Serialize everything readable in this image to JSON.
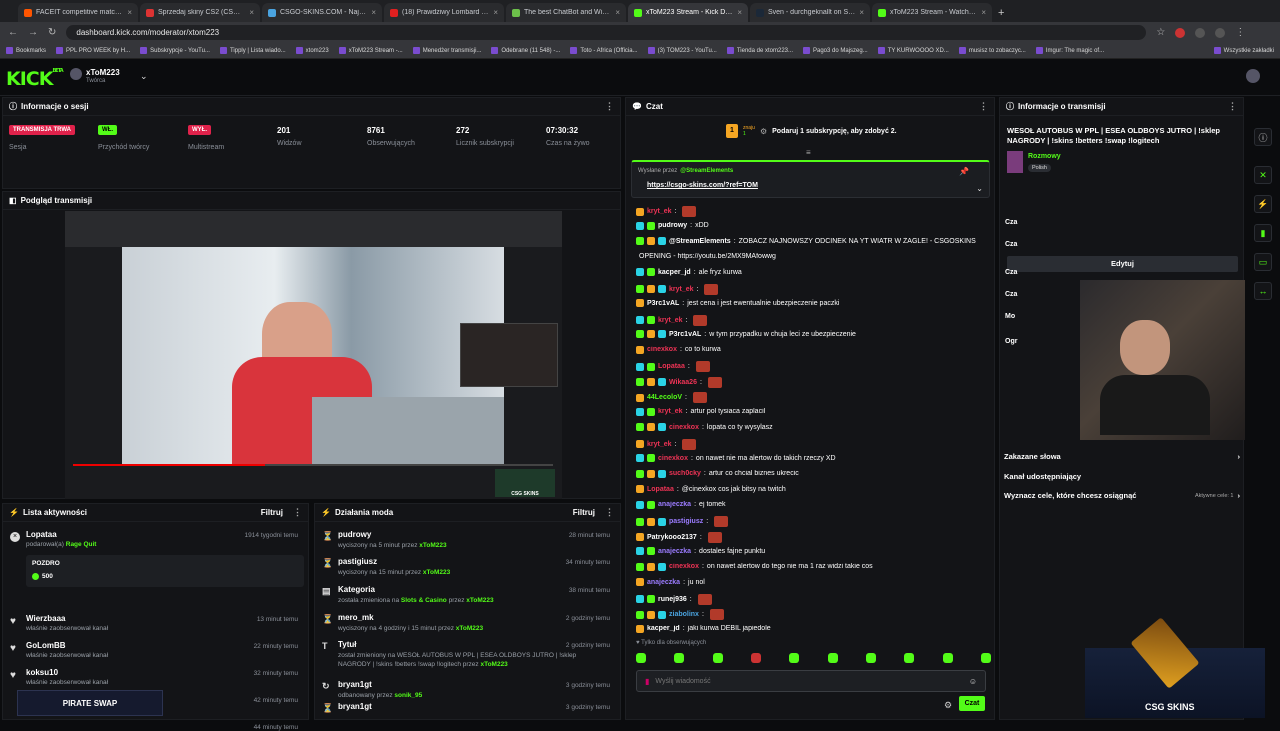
{
  "tabs": [
    {
      "title": "FACEIT competitive match - FAC",
      "color": "#ff5500"
    },
    {
      "title": "Sprzedaj skiny CS2 (CSGO) | N",
      "color": "#d33"
    },
    {
      "title": "CSGO-SKINS.COM - Najlepsze",
      "color": "#4aa3df"
    },
    {
      "title": "(18) Prawdziwy Lombard - Odc",
      "color": "#e02020"
    },
    {
      "title": "The best ChatBot and Widgets",
      "color": "#6cc04a"
    },
    {
      "title": "xToM223 Stream - Kick Dashbo",
      "color": "#53fc18"
    },
    {
      "title": "Sven - durchgeknallt on Steam",
      "color": "#1b2838"
    },
    {
      "title": "xToM223 Stream - Watch Live",
      "color": "#53fc18"
    }
  ],
  "url": "dashboard.kick.com/moderator/xtom223",
  "bookmarks": [
    "Bookmarks",
    "PPL PRO WEEK by H...",
    "Subskrypcje - YouTu...",
    "Tipply | Lista wiado...",
    "xtom223",
    "xToM223 Stream -...",
    "Menedżer transmisji...",
    "Odebrane (11 548) -...",
    "Toto - Africa (Officia...",
    "(3) TOM223 - YouTu...",
    "Tienda de xtom223...",
    "Pago3 do Majszeg...",
    "TY KURWOOOO XD...",
    "musisz to zobaczyc...",
    "Imgur: The magic of...",
    "Wszystkie zakładki"
  ],
  "header": {
    "logo": "KICK",
    "beta": "BETA",
    "user": "xToM223",
    "role": "Twórca"
  },
  "session": {
    "title": "Informacje o sesji",
    "live_badge": "TRANSMISJA TRWA",
    "live_label": "Sesja",
    "rev_badge": "WŁ.",
    "rev_label": "Przychód twórcy",
    "multi_badge": "WYŁ.",
    "multi_label": "Multistream",
    "viewers": "201",
    "viewers_label": "Widzów",
    "followers": "8761",
    "followers_label": "Obserwujących",
    "subs": "272",
    "subs_label": "Licznik subskrypcji",
    "uptime": "07:30:32",
    "uptime_label": "Czas na żywo"
  },
  "preview": {
    "title": "Podgląd transmisji",
    "overlay_brand": "CSG SKINS"
  },
  "activity": {
    "title": "Lista aktywności",
    "filter": "Filtruj",
    "items": [
      {
        "name": "Lopataa",
        "desc": "podarował(a)",
        "extra": "Rage Quit",
        "time": "1914 tygodni temu",
        "note_title": "POZDRO",
        "note_val": "500"
      },
      {
        "name": "Wierzbaaa",
        "desc": "właśnie zaobserwował kanał",
        "time": "13 minut temu"
      },
      {
        "name": "GoLomBB",
        "desc": "właśnie zaobserwował kanał",
        "time": "22 minuty temu"
      },
      {
        "name": "koksu10",
        "desc": "właśnie zaobserwował kanał",
        "time": "32 minuty temu"
      },
      {
        "time": "42 minuty temu"
      },
      {
        "time": "44 minuty temu"
      }
    ],
    "promo": "PIRATE SWAP"
  },
  "mod": {
    "title": "Działania moda",
    "filter": "Filtruj",
    "items": [
      {
        "name": "pudrowy",
        "desc": "wyciszony na 5 minut przez",
        "by": "xToM223",
        "time": "28 minut temu"
      },
      {
        "name": "pastigiusz",
        "desc": "wyciszony na 15 minut przez",
        "by": "xToM223",
        "time": "34 minuty temu"
      },
      {
        "name": "Kategoria",
        "desc": "została zmieniona na",
        "extra": "Slots & Casino",
        "desc2": "przez",
        "by": "xToM223",
        "time": "38 minut temu"
      },
      {
        "name": "mero_mk",
        "desc": "wyciszony na 4 godziny i 15 minut przez",
        "by": "xToM223",
        "time": "2 godziny temu"
      },
      {
        "name": "Tytuł",
        "desc": "został zmieniony na WESOŁ AUTOBUS W PPL | ESEA OLDBOYS JUTRO | !sklep NAGRODY | !skins !betters !swap !logitech przez",
        "by": "xToM223",
        "time": "2 godziny temu"
      },
      {
        "name": "bryan1gt",
        "desc": "odbanowany przez",
        "by": "sonik_95",
        "time": "3 godziny temu"
      },
      {
        "name": "bryan1gt",
        "time": "3 godziny temu"
      }
    ]
  },
  "chat": {
    "title": "Czat",
    "sub_goal": "Podaruj 1 subskrypcję, aby zdobyć 2.",
    "goal_small": "znaju",
    "goal_count": "1",
    "pinned_by": "Wysłane przez",
    "pinned_user": "@StreamElements",
    "pinned_link": "https://csgo-skins.com/?ref=TOM",
    "messages": [
      {
        "u": "kryt_ek",
        "c": "#e35",
        "t": "",
        "e": true
      },
      {
        "u": "pudrowy",
        "c": "#fff",
        "t": "xDD"
      },
      {
        "u": "@StreamElements",
        "c": "#fff",
        "t": "ZOBACZ NAJNOWSZY ODCINEK NA YT  WIATR W ŻAGLE! - CSGOSKINS"
      },
      {
        "u": "",
        "c": "#fff",
        "t": "OPENING - https://youtu.be/2MX9MAfowwg"
      },
      {
        "u": "kacper_jd",
        "c": "#fff",
        "t": "ale fryz kurwa"
      },
      {
        "u": "kryt_ek",
        "c": "#e35",
        "t": "",
        "e": true
      },
      {
        "u": "P3rc1vAL",
        "c": "#fff",
        "t": "jest cena i jest ewentualnie ubezpieczenie paczki"
      },
      {
        "u": "kryt_ek",
        "c": "#e35",
        "t": "",
        "e": true
      },
      {
        "u": "P3rc1vAL",
        "c": "#fff",
        "t": "w tym przypadku w chuja leci ze ubezpieczenie"
      },
      {
        "u": "cinexkox",
        "c": "#e35",
        "t": "co to kurwa"
      },
      {
        "u": "Lopataa",
        "c": "#e35",
        "t": "",
        "e": true
      },
      {
        "u": "Wikaa26",
        "c": "#e35",
        "t": "",
        "e": true
      },
      {
        "u": "44LecoloV",
        "c": "#53fc18",
        "t": "",
        "e": true
      },
      {
        "u": "kryt_ek",
        "c": "#e35",
        "t": "artur pol tysiaca zaplacil"
      },
      {
        "u": "cinexkox",
        "c": "#e35",
        "t": "lopata co ty wysylasz"
      },
      {
        "u": "kryt_ek",
        "c": "#e35",
        "t": "",
        "e": true
      },
      {
        "u": "cinexkox",
        "c": "#e35",
        "t": "on nawet nie ma alertow do takich rzeczy XD"
      },
      {
        "u": "such0cky",
        "c": "#e35",
        "t": "artur co chcial biznes ukrecic"
      },
      {
        "u": "Lopataa",
        "c": "#e35",
        "t": "@cinexkox cos jak bitsy na twitch"
      },
      {
        "u": "anajeczka",
        "c": "#9b7cff",
        "t": "ej tomek"
      },
      {
        "u": "pastigiusz",
        "c": "#9b7cff",
        "t": "",
        "e": true
      },
      {
        "u": "Patrykooo2137",
        "c": "#fff",
        "t": "",
        "e": true
      },
      {
        "u": "anajeczka",
        "c": "#9b7cff",
        "t": "dostales fajne punktu"
      },
      {
        "u": "cinexkox",
        "c": "#e35",
        "t": "on nawet alertow do tego nie ma 1 raz widzi takie cos"
      },
      {
        "u": "anajeczka",
        "c": "#9b7cff",
        "t": "ju nol"
      },
      {
        "u": "runej936",
        "c": "#fff",
        "t": "",
        "e": true
      },
      {
        "u": "ziabolinx",
        "c": "#4aa3df",
        "t": "",
        "e": true
      },
      {
        "u": "kacper_jd",
        "c": "#fff",
        "t": "jaki kurwa  DEBIL  japiedole"
      }
    ],
    "followers_only": "Tylko dla obserwujących",
    "input_placeholder": "Wyślij wiadomość",
    "send": "Czat"
  },
  "stream_info": {
    "title": "Informacje o transmisji",
    "stream_title": "WESOŁ AUTOBUS W PPL | ESEA OLDBOYS JUTRO | !sklep NAGRODY | !skins !betters !swap !logitech",
    "category": "Rozmowy",
    "lang": "Polish",
    "edit": "Edytuj",
    "opt1": "Zakazane słowa",
    "opt2": "Kanał udostępniający",
    "opt3": "Wyznacz cele, które chcesz osiągnąć",
    "opt3_status": "Aktywne cele: 1",
    "partial": [
      "Ogr",
      "Cza",
      "Cza",
      "Cza",
      "Cza",
      "Mo"
    ]
  },
  "overlay": {
    "brand": "CSG SKINS"
  }
}
